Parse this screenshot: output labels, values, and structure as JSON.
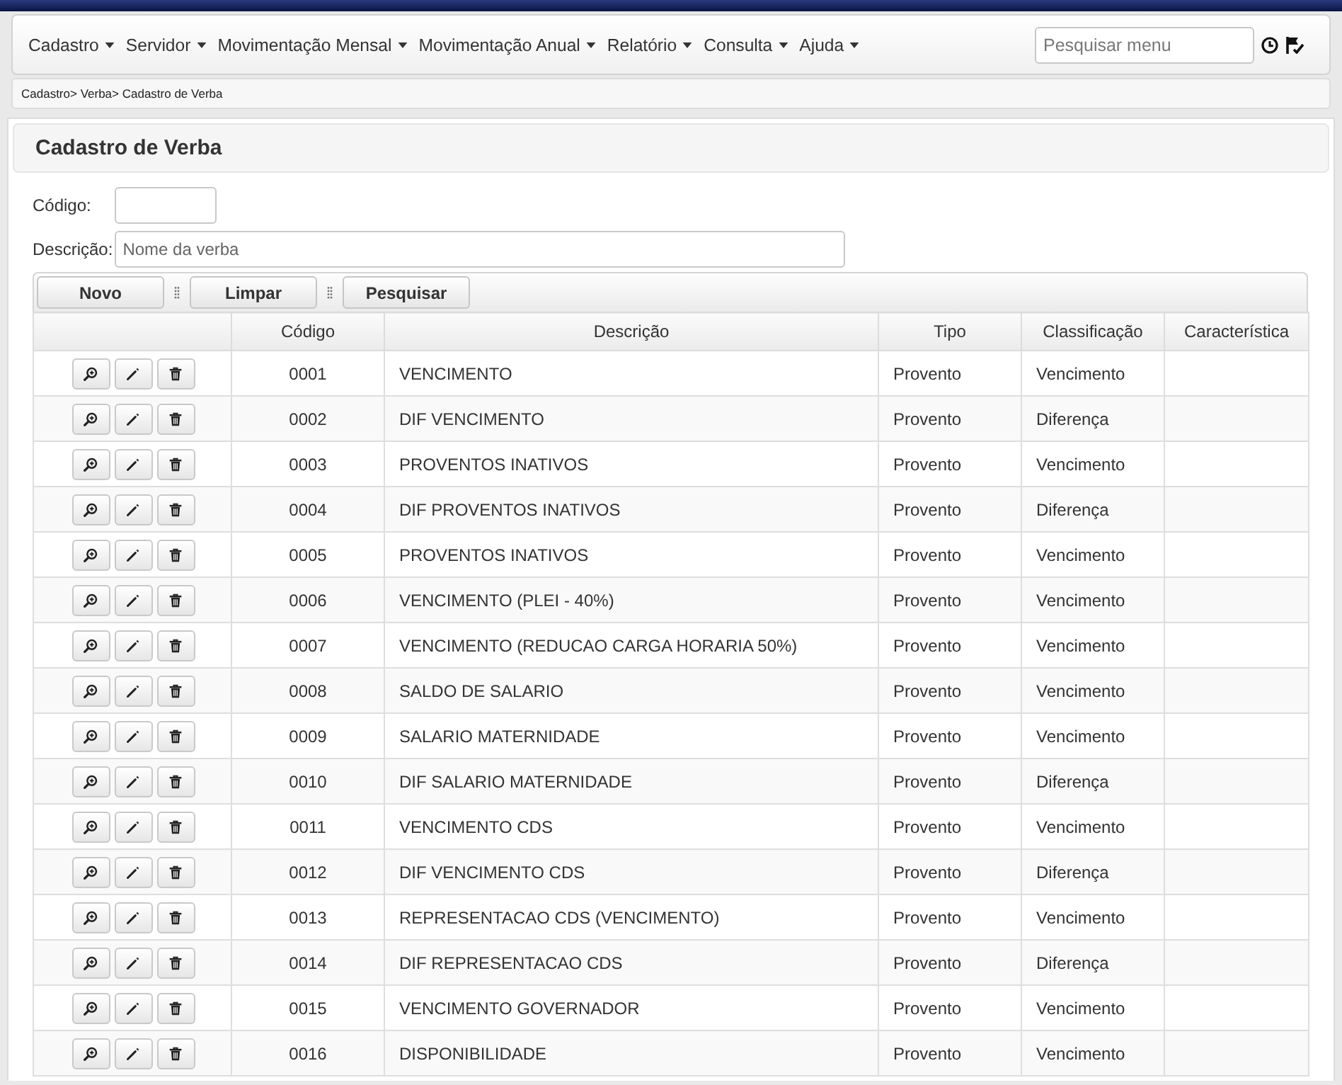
{
  "navbar": {
    "menus": [
      {
        "label": "Cadastro"
      },
      {
        "label": "Servidor"
      },
      {
        "label": "Movimentação Mensal"
      },
      {
        "label": "Movimentação Anual"
      },
      {
        "label": "Relatório"
      },
      {
        "label": "Consulta"
      },
      {
        "label": "Ajuda"
      }
    ],
    "search": {
      "placeholder": "Pesquisar menu"
    }
  },
  "breadcrumb": "Cadastro> Verba> Cadastro de Verba",
  "panel": {
    "title": "Cadastro de Verba",
    "fields": [
      {
        "label": "Código:"
      },
      {
        "label": "Descrição:",
        "placeholder": "Nome da verba"
      }
    ],
    "toolbar": {
      "buttons": [
        "Novo",
        "Limpar",
        "Pesquisar"
      ]
    },
    "table": {
      "columns": [
        "Código",
        "Descrição",
        "Tipo",
        "Classificação",
        "Característica"
      ],
      "rows": [
        {
          "code": "0001",
          "description": "VENCIMENTO",
          "type": "Provento",
          "classification": "Vencimento"
        },
        {
          "code": "0002",
          "description": "DIF VENCIMENTO",
          "type": "Provento",
          "classification": "Diferença"
        },
        {
          "code": "0003",
          "description": "PROVENTOS INATIVOS",
          "type": "Provento",
          "classification": "Vencimento"
        },
        {
          "code": "0004",
          "description": "DIF PROVENTOS INATIVOS",
          "type": "Provento",
          "classification": "Diferença"
        },
        {
          "code": "0005",
          "description": "PROVENTOS INATIVOS",
          "type": "Provento",
          "classification": "Vencimento"
        },
        {
          "code": "0006",
          "description": "VENCIMENTO (PLEI - 40%)",
          "type": "Provento",
          "classification": "Vencimento"
        },
        {
          "code": "0007",
          "description": "VENCIMENTO (REDUCAO CARGA HORARIA 50%)",
          "type": "Provento",
          "classification": "Vencimento"
        },
        {
          "code": "0008",
          "description": "SALDO DE SALARIO",
          "type": "Provento",
          "classification": "Vencimento"
        },
        {
          "code": "0009",
          "description": "SALARIO MATERNIDADE",
          "type": "Provento",
          "classification": "Vencimento"
        },
        {
          "code": "0010",
          "description": "DIF SALARIO MATERNIDADE",
          "type": "Provento",
          "classification": "Diferença"
        },
        {
          "code": "0011",
          "description": "VENCIMENTO CDS",
          "type": "Provento",
          "classification": "Vencimento"
        },
        {
          "code": "0012",
          "description": "DIF VENCIMENTO CDS",
          "type": "Provento",
          "classification": "Diferença"
        },
        {
          "code": "0013",
          "description": "REPRESENTACAO CDS (VENCIMENTO)",
          "type": "Provento",
          "classification": "Vencimento"
        },
        {
          "code": "0014",
          "description": "DIF REPRESENTACAO CDS",
          "type": "Provento",
          "classification": "Diferença"
        },
        {
          "code": "0015",
          "description": "VENCIMENTO GOVERNADOR",
          "type": "Provento",
          "classification": "Vencimento"
        },
        {
          "code": "0016",
          "description": "DISPONIBILIDADE",
          "type": "Provento",
          "classification": "Vencimento"
        }
      ]
    }
  }
}
